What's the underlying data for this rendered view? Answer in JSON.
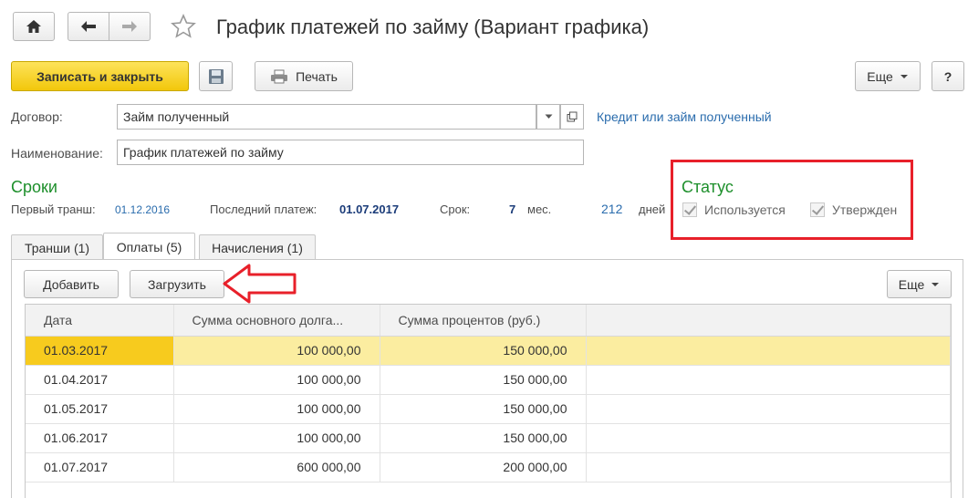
{
  "window": {
    "title": "График платежей по займу (Вариант графика)"
  },
  "toolbar": {
    "save_close_label": "Записать и закрыть",
    "print_label": "Печать",
    "more_label": "Еще",
    "help_label": "?"
  },
  "form": {
    "contract_label": "Договор:",
    "contract_value": "Займ полученный",
    "contract_link": "Кредит или займ полученный",
    "name_label": "Наименование:",
    "name_value": "График платежей по займу"
  },
  "terms": {
    "heading": "Сроки",
    "first_tranche_label": "Первый транш:",
    "first_tranche_value": "01.12.2016",
    "last_payment_label": "Последний платеж:",
    "last_payment_value": "01.07.2017",
    "term_label": "Срок:",
    "term_months": "7",
    "months_unit": "мес.",
    "term_days": "212",
    "days_unit": "дней"
  },
  "status": {
    "heading": "Статус",
    "used_label": "Используется",
    "approved_label": "Утвержден",
    "highlight_color": "#e8202a"
  },
  "tabs": [
    {
      "label": "Транши (1)"
    },
    {
      "label": "Оплаты (5)"
    },
    {
      "label": "Начисления (1)"
    }
  ],
  "table_toolbar": {
    "add_label": "Добавить",
    "load_label": "Загрузить",
    "more_label": "Еще"
  },
  "table": {
    "columns": [
      "Дата",
      "Сумма основного долга...",
      "Сумма процентов (руб.)"
    ],
    "rows": [
      [
        "01.03.2017",
        "100 000,00",
        "150 000,00"
      ],
      [
        "01.04.2017",
        "100 000,00",
        "150 000,00"
      ],
      [
        "01.05.2017",
        "100 000,00",
        "150 000,00"
      ],
      [
        "01.06.2017",
        "100 000,00",
        "150 000,00"
      ],
      [
        "01.07.2017",
        "600 000,00",
        "200 000,00"
      ]
    ]
  },
  "icons": {
    "home": "home-icon",
    "back": "arrow-left-icon",
    "forward": "arrow-right-icon",
    "star": "star-icon",
    "save": "floppy-disk-icon",
    "print": "printer-icon",
    "dropdown": "chevron-down-icon",
    "open": "open-form-icon",
    "pointer": "red-arrow-icon"
  }
}
